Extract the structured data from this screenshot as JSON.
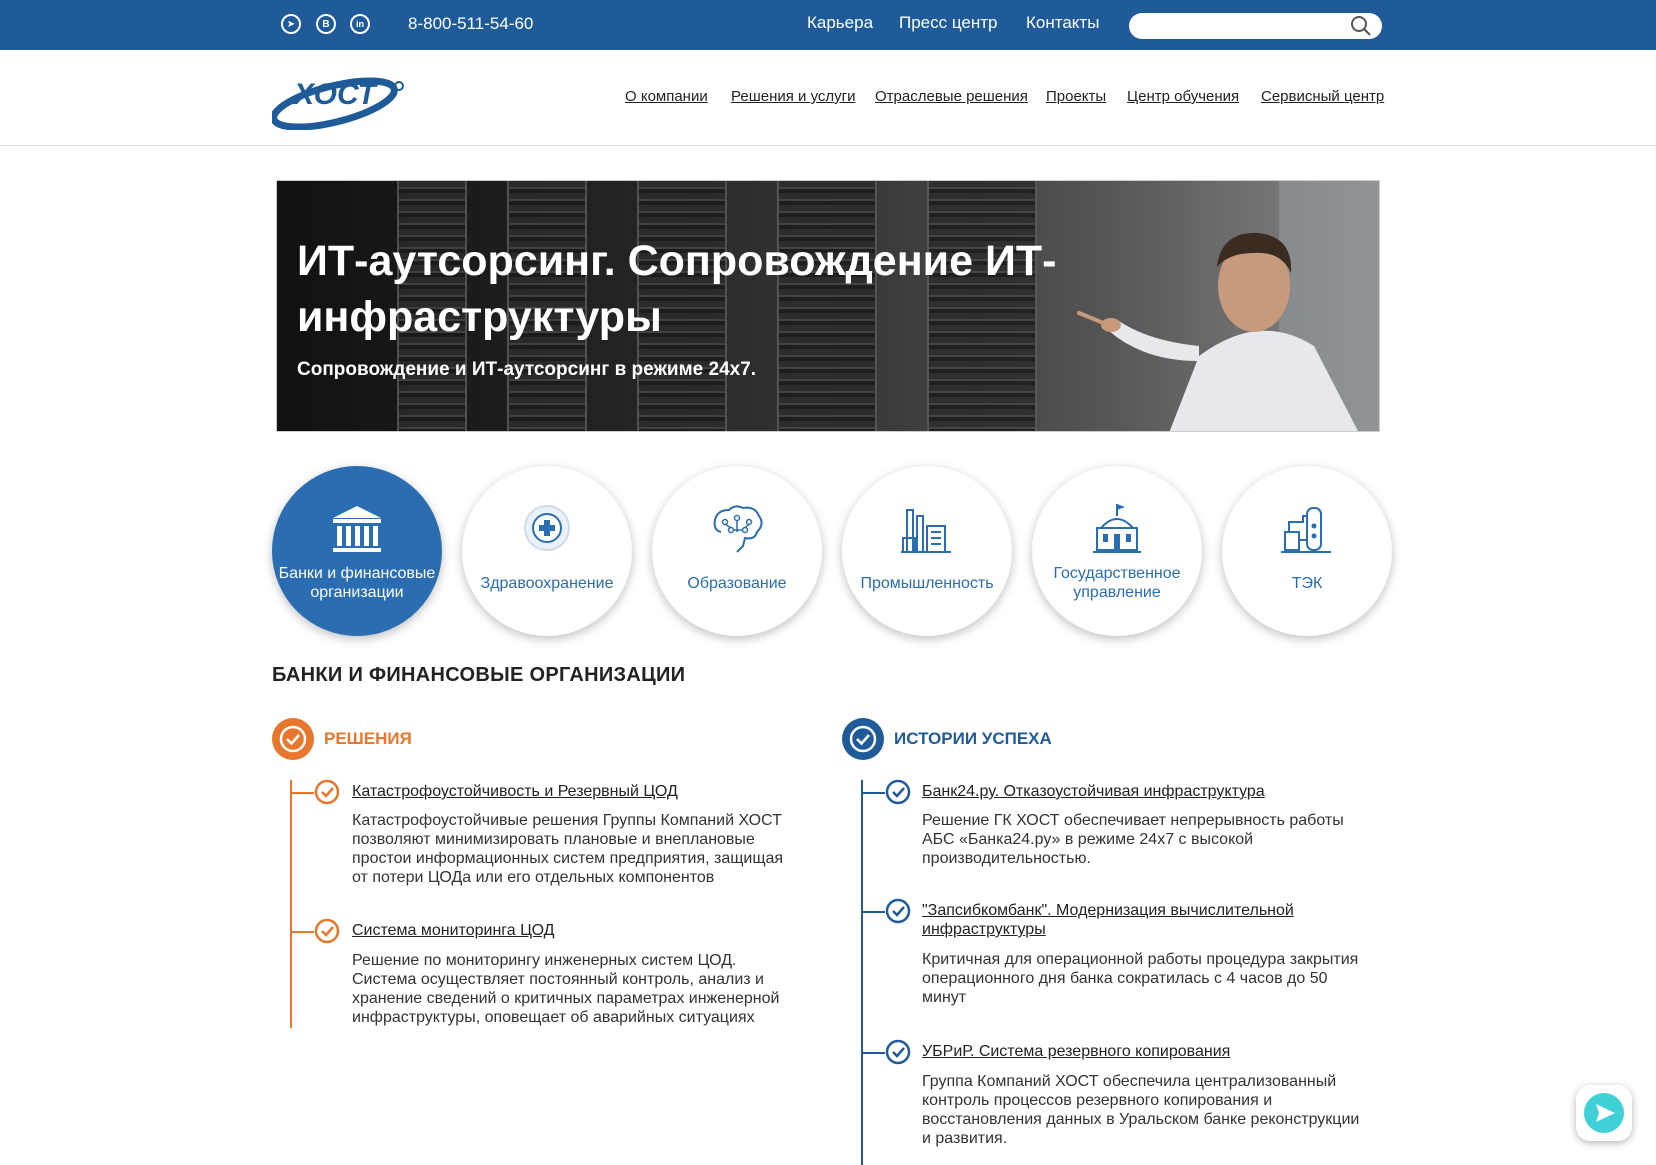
{
  "topbar": {
    "social": [
      {
        "name": "telegram",
        "glyph": "➤"
      },
      {
        "name": "vk",
        "glyph": "B"
      },
      {
        "name": "linkedin",
        "glyph": "in"
      }
    ],
    "phone": "8-800-511-54-60",
    "links": [
      "Карьера",
      "Пресс центр",
      "Контакты"
    ],
    "search_value": ""
  },
  "header": {
    "logo_text": "ХОСТ",
    "nav": [
      "О компании",
      "Решения и услуги",
      "Отраслевые решения",
      "Проекты",
      "Центр обучения",
      "Сервисный центр"
    ]
  },
  "hero": {
    "title": "ИТ-аутсорсинг. Сопровождение ИТ-инфраструктуры",
    "subtitle": "Сопровождение и ИТ-аутсорсинг в режиме 24х7."
  },
  "categories": [
    {
      "line1": "Банки и финансовые",
      "line2": "организации",
      "icon": "bank-icon",
      "active": true
    },
    {
      "line1": "Здравоохранение",
      "line2": "",
      "icon": "healthcare-icon",
      "active": false
    },
    {
      "line1": "Образование",
      "line2": "",
      "icon": "brain-icon",
      "active": false
    },
    {
      "line1": "Промышленность",
      "line2": "",
      "icon": "factory-icon",
      "active": false
    },
    {
      "line1": "Государственное",
      "line2": "управление",
      "icon": "government-icon",
      "active": false
    },
    {
      "line1": "ТЭК",
      "line2": "",
      "icon": "energy-icon",
      "active": false
    }
  ],
  "section": {
    "title": "БАНКИ И ФИНАНСОВЫЕ ОРГАНИЗАЦИИ",
    "solutions": {
      "heading": "РЕШЕНИЯ",
      "items": [
        {
          "title": "Катастрофоустойчивость и Резервный ЦОД",
          "lines": [
            "Катастрофоустойчивые решения Группы Компаний ХОСТ",
            "позволяют минимизировать плановые и внеплановые",
            "простои информационных систем предприятия, защищая",
            "от потери ЦОДа или его отдельных компонентов"
          ]
        },
        {
          "title": "Система мониторинга ЦОД",
          "lines": [
            "Решение по мониторингу инженерных систем ЦОД.",
            "Система осуществляет постоянный контроль, анализ и",
            "хранение сведений о критичных параметрах инженерной",
            "инфраструктуры, оповещает об аварийных ситуациях"
          ]
        }
      ]
    },
    "stories": {
      "heading": "ИСТОРИИ УСПЕХА",
      "items": [
        {
          "title_lines": [
            "Банк24.ру. Отказоустойчивая инфраструктура"
          ],
          "lines": [
            "Решение ГК ХОСТ обеспечивает непрерывность работы",
            "АБС «Банка24.ру» в режиме 24х7 с высокой",
            "производительностью."
          ]
        },
        {
          "title_lines": [
            "\"Запсибкомбанк\". Модернизация вычислительной",
            "инфраструктуры"
          ],
          "lines": [
            "Критичная для операционной работы процедура закрытия",
            "операционного дня банка сократилась с 4 часов до 50",
            "минут"
          ]
        },
        {
          "title_lines": [
            "УБРиР. Система резервного копирования"
          ],
          "lines": [
            "Группа Компаний ХОСТ обеспечила централизованный",
            "контроль процессов резервного копирования и",
            "восстановления данных в Уральском банке реконструкции",
            "и развития."
          ]
        }
      ]
    }
  },
  "colors": {
    "brand_blue": "#1e5b98",
    "accent_blue": "#2a6db0",
    "accent_orange": "#e8762c"
  }
}
